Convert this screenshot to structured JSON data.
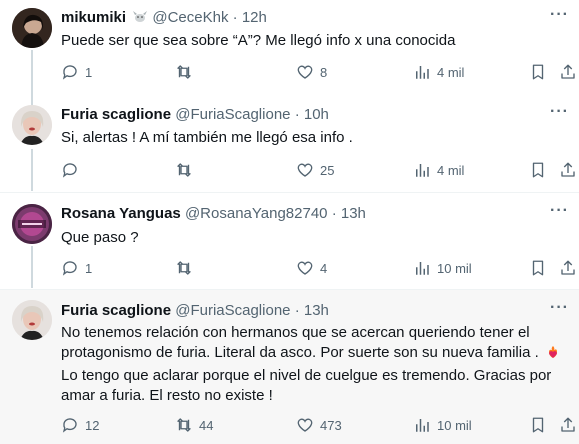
{
  "tweets": [
    {
      "name": "mikumiki",
      "handle": "@CeceKhk",
      "time": "12h",
      "text": "Puede ser que sea sobre “A”? Me llegó info x una conocida",
      "replies": "1",
      "retweets": "",
      "likes": "8",
      "views": "4 mil"
    },
    {
      "name": "Furia scaglione",
      "handle": "@FuriaScaglione",
      "time": "10h",
      "text": "Si, alertas ! A mí también me llegó esa info .",
      "replies": "",
      "retweets": "",
      "likes": "25",
      "views": "4 mil"
    },
    {
      "name": "Rosana Yanguas",
      "handle": "@RosanaYang82740",
      "time": "13h",
      "text": "Que paso ?",
      "replies": "1",
      "retweets": "",
      "likes": "4",
      "views": "10 mil"
    },
    {
      "name": "Furia scaglione",
      "handle": "@FuriaScaglione",
      "time": "13h",
      "text_lines": [
        "No tenemos relación con hermanos que se acercan queriendo tener el",
        "protagonismo de furia. Literal da asco.  Por suerte son su nueva familia .",
        "Lo tengo que aclarar porque el nivel de cuelgue es tremendo.  Gracias por",
        "amar a furia. El resto no existe !"
      ],
      "replies": "12",
      "retweets": "44",
      "likes": "473",
      "views": "10 mil"
    }
  ],
  "separator": "·",
  "more_glyph": "···",
  "colors": {
    "text": "#0f1419",
    "muted": "#536471",
    "divider": "#eff3f4",
    "highlight": "#f7f7f7"
  },
  "icons": [
    "reply-icon",
    "retweet-icon",
    "like-icon",
    "views-icon",
    "bookmark-icon",
    "share-icon",
    "goat-badge-icon",
    "heart-fire-emoji-icon"
  ]
}
